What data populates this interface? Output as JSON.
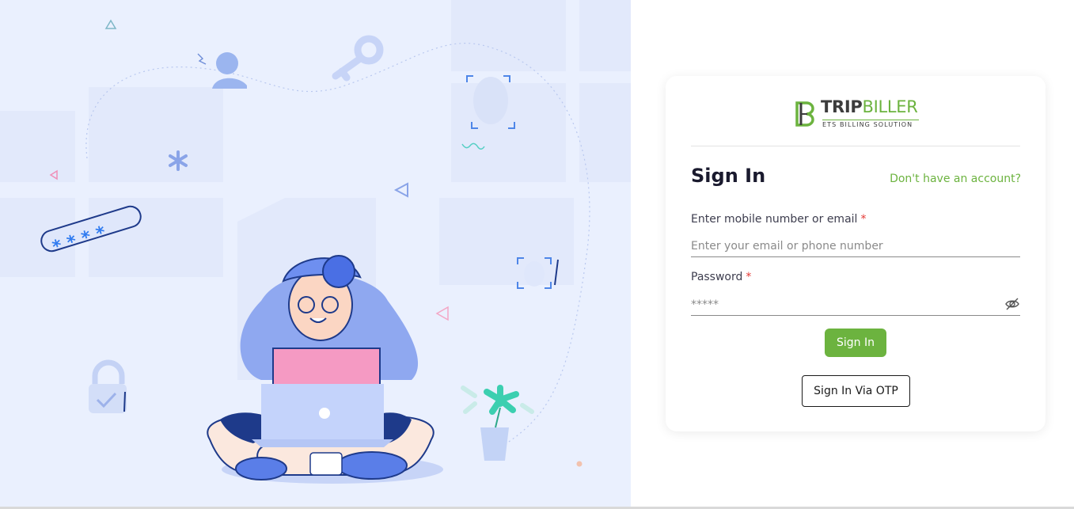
{
  "brand": {
    "name_part1": "TRIP",
    "name_part2": "BILLER",
    "tagline": "ETS BILLING SOLUTION",
    "color_primary": "#6cb33f",
    "color_dark": "#3c3c3c"
  },
  "signin": {
    "title": "Sign In",
    "signup_link": "Don't have an account?",
    "email_label": "Enter mobile number or email",
    "email_placeholder": "Enter your email or phone number",
    "password_label": "Password",
    "password_placeholder": "*****",
    "required_mark": "*",
    "submit_label": "Sign In",
    "otp_label": "Sign In Via OTP"
  },
  "icons": {
    "password_toggle": "eye-slash-icon",
    "logo": "tripbiller-logo-icon"
  },
  "illustration": {
    "subject": "woman-with-laptop-security-illustration",
    "background_color": "#eaf0fe"
  }
}
